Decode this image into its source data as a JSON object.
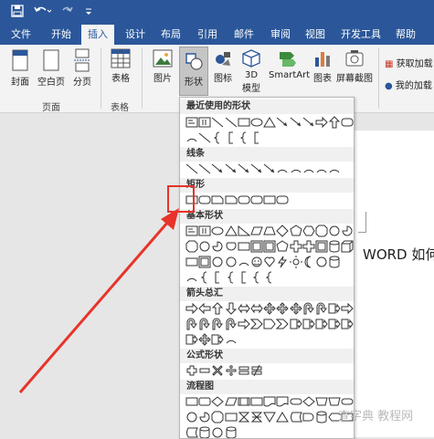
{
  "qat": {
    "save_icon": "save-icon",
    "undo_icon": "undo-icon",
    "redo_icon": "redo-icon",
    "customize_icon": "customize-icon"
  },
  "tabs": [
    "文件",
    "开始",
    "插入",
    "设计",
    "布局",
    "引用",
    "邮件",
    "审阅",
    "视图",
    "开发工具",
    "帮助"
  ],
  "active_tab": "插入",
  "ribbon": {
    "cover": "封面",
    "blank": "空白页",
    "pagebreak": "分页",
    "pages_group": "页面",
    "table": "表格",
    "tables_group": "表格",
    "picture": "图片",
    "shapes": "形状",
    "icons": "图标",
    "model3d_line1": "3D",
    "model3d_line2": "模型",
    "smartart": "SmartArt",
    "chart": "图表",
    "screenshot": "屏幕截图",
    "getaddins": "获取加载",
    "myaddins": "我的加载"
  },
  "gallery": {
    "recent": "最近使用的形状",
    "lines": "线条",
    "rect": "矩形",
    "basic": "基本形状",
    "arrows": "箭头总汇",
    "equation": "公式形状",
    "flowchart": "流程图"
  },
  "document": {
    "text": "WORD 如何"
  },
  "watermark": "查字典 教程网",
  "colors": {
    "accent": "#2b579a",
    "highlight": "#e8332a"
  }
}
